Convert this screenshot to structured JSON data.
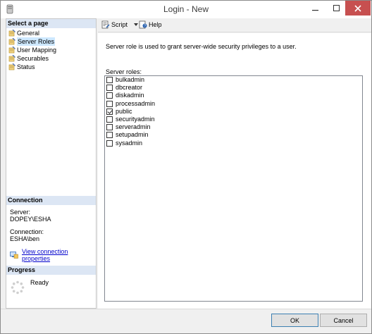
{
  "window": {
    "title": "Login - New",
    "close_color": "#c75050"
  },
  "select_page": {
    "header": "Select a page",
    "items": [
      {
        "label": "General",
        "selected": false
      },
      {
        "label": "Server Roles",
        "selected": true
      },
      {
        "label": "User Mapping",
        "selected": false
      },
      {
        "label": "Securables",
        "selected": false
      },
      {
        "label": "Status",
        "selected": false
      }
    ]
  },
  "connection": {
    "header": "Connection",
    "server_label": "Server:",
    "server_value": "DOPEY\\ESHA",
    "connection_label": "Connection:",
    "connection_value": "ESHA\\ben",
    "view_link": "View connection properties"
  },
  "progress": {
    "header": "Progress",
    "status": "Ready"
  },
  "toolbar": {
    "script_label": "Script",
    "help_label": "Help"
  },
  "content": {
    "description": "Server role is used to grant server-wide security privileges to a user.",
    "roles_label": "Server roles:",
    "roles": [
      {
        "name": "bulkadmin",
        "checked": false
      },
      {
        "name": "dbcreator",
        "checked": false
      },
      {
        "name": "diskadmin",
        "checked": false
      },
      {
        "name": "processadmin",
        "checked": false
      },
      {
        "name": "public",
        "checked": true
      },
      {
        "name": "securityadmin",
        "checked": false
      },
      {
        "name": "serveradmin",
        "checked": false
      },
      {
        "name": "setupadmin",
        "checked": false
      },
      {
        "name": "sysadmin",
        "checked": false
      }
    ]
  },
  "buttons": {
    "ok_label": "OK",
    "cancel_label": "Cancel"
  },
  "icons": {
    "app": "app-icon",
    "page": "page-icon",
    "connection": "connection-icon",
    "script": "script-icon",
    "help": "help-icon",
    "spinner": "spinner-icon"
  }
}
